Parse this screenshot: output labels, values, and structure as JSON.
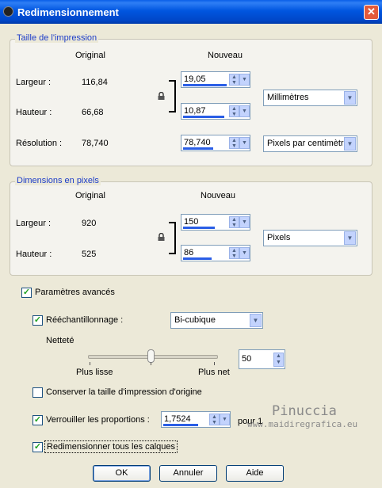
{
  "window": {
    "title": "Redimensionnement"
  },
  "print_size": {
    "group_title": "Taille de l'impression",
    "col_original": "Original",
    "col_new": "Nouveau",
    "width_label": "Largeur :",
    "width_original": "116,84",
    "width_new": "19,05",
    "height_label": "Hauteur :",
    "height_original": "66,68",
    "height_new": "10,87",
    "resolution_label": "Résolution :",
    "resolution_original": "78,740",
    "resolution_new": "78,740",
    "unit": "Millimètres",
    "resolution_unit": "Pixels par centimètre"
  },
  "pixel_size": {
    "group_title": "Dimensions en pixels",
    "col_original": "Original",
    "col_new": "Nouveau",
    "width_label": "Largeur :",
    "width_original": "920",
    "width_new": "150",
    "height_label": "Hauteur :",
    "height_original": "525",
    "height_new": "86",
    "unit": "Pixels"
  },
  "advanced": {
    "label": "Paramètres avancés",
    "checked": true,
    "resample_label": "Rééchantillonnage :",
    "resample_checked": true,
    "resample_method": "Bi-cubique",
    "sharpness_label": "Netteté",
    "slider_min_label": "Plus lisse",
    "slider_max_label": "Plus net",
    "sharpness_value": "50",
    "keep_print_size_label": "Conserver la taille d'impression d'origine",
    "keep_print_size_checked": false,
    "lock_ratio_label": "Verrouiller les proportions :",
    "lock_ratio_checked": true,
    "ratio_value": "1,7524",
    "ratio_suffix": "pour 1",
    "resize_layers_label": "Redimensionner tous les calques",
    "resize_layers_checked": true
  },
  "buttons": {
    "ok": "OK",
    "cancel": "Annuler",
    "help": "Aide"
  },
  "watermark": {
    "name": "Pinuccia",
    "url": "www.maidiregrafica.eu"
  },
  "colors": {
    "titlebar": "#0054e3",
    "group_title": "#1c3cc8",
    "progress": "#2a5ee6",
    "checkmark": "#21a121"
  }
}
